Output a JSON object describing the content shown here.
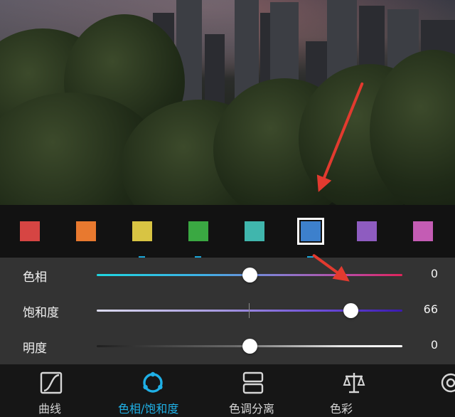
{
  "colors": [
    {
      "name": "red",
      "hex": "#d64543",
      "indicator": false,
      "selected": false
    },
    {
      "name": "orange",
      "hex": "#e8792f",
      "indicator": false,
      "selected": false
    },
    {
      "name": "yellow",
      "hex": "#d8c443",
      "indicator": true,
      "selected": false
    },
    {
      "name": "green",
      "hex": "#3aa842",
      "indicator": true,
      "selected": false
    },
    {
      "name": "aqua",
      "hex": "#40b6ad",
      "indicator": false,
      "selected": false
    },
    {
      "name": "blue",
      "hex": "#3d80cc",
      "indicator": true,
      "selected": true
    },
    {
      "name": "purple",
      "hex": "#8e5cc0",
      "indicator": false,
      "selected": false
    },
    {
      "name": "magenta",
      "hex": "#c45cb4",
      "indicator": false,
      "selected": false
    }
  ],
  "sliders": [
    {
      "label": "色相",
      "value": "0",
      "level_percent": 50,
      "show_center_tick": false,
      "track_gradient": "linear-gradient(90deg, #1fd6e0 0%, #3fb0e6 35%, #8a7ad0 60%, #c0449a 85%, #e0245a 100%)"
    },
    {
      "label": "饱和度",
      "value": "66",
      "level_percent": 83,
      "show_center_tick": true,
      "track_gradient": "linear-gradient(90deg, #dcdcf0 0%, #a79ae0 40%, #6a4ad8 75%, #3a1ab0 100%)"
    },
    {
      "label": "明度",
      "value": "0",
      "level_percent": 50,
      "show_center_tick": false,
      "track_gradient": "linear-gradient(90deg, #202020 0%, #6a6a6a 45%, #e6e6e6 80%, #ffffff 100%)"
    }
  ],
  "nav": [
    {
      "label": "曲线",
      "icon": "curve-icon",
      "active": false
    },
    {
      "label": "色相/饱和度",
      "icon": "hue-ring-icon",
      "active": true
    },
    {
      "label": "色调分离",
      "icon": "split-tone-icon",
      "active": false
    },
    {
      "label": "色彩",
      "icon": "balance-icon",
      "active": false
    },
    {
      "label": "",
      "icon": "more-tool-icon",
      "active": false
    }
  ],
  "accent_color": "#1fb0e6"
}
